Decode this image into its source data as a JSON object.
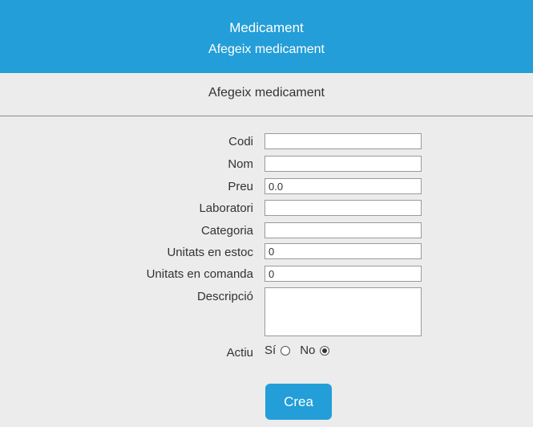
{
  "header": {
    "title": "Medicament",
    "subtitle": "Afegeix medicament"
  },
  "subbar": {
    "label": "Afegeix medicament"
  },
  "form": {
    "fields": [
      {
        "label": "Codi",
        "value": ""
      },
      {
        "label": "Nom",
        "value": ""
      },
      {
        "label": "Preu",
        "value": "0.0"
      },
      {
        "label": "Laboratori",
        "value": ""
      },
      {
        "label": "Categoria",
        "value": ""
      },
      {
        "label": "Unitats en estoc",
        "value": "0"
      },
      {
        "label": "Unitats en comanda",
        "value": "0"
      },
      {
        "label": "Descripció",
        "value": ""
      }
    ],
    "actiu": {
      "label": "Actiu",
      "options": [
        "Sí",
        "No"
      ],
      "selected": "No"
    },
    "submit_label": "Crea"
  },
  "colors": {
    "accent": "#239ed8",
    "background": "#ececec"
  }
}
